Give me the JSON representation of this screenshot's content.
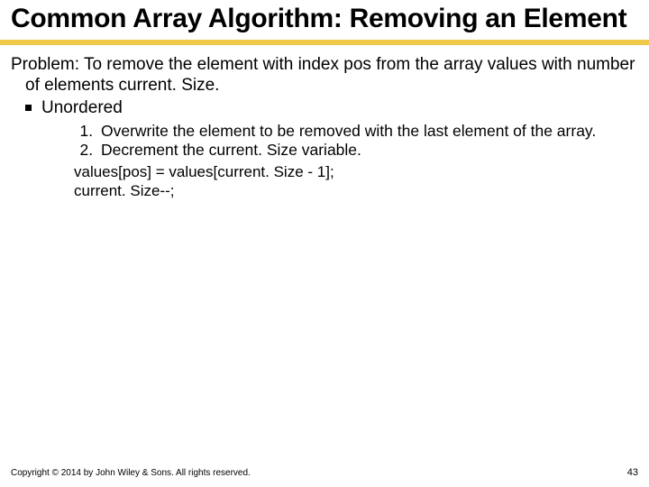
{
  "title": "Common Array Algorithm: Removing an Element",
  "problem": {
    "p1": "Problem: To remove the element with index ",
    "pos": "pos",
    "p2": " from the array ",
    "values": "values",
    "p3": " with number of elements ",
    "current": "current. Size",
    "p4": "."
  },
  "bullets": [
    {
      "label": "Unordered",
      "steps": [
        "Overwrite the element to be removed with the last element of the array."
      ],
      "step2a": "Decrement the ",
      "step2var": "current. Size",
      "step2b": " variable."
    }
  ],
  "code": [
    "values[pos] = values[current. Size - 1];",
    "current. Size--;"
  ],
  "footer": {
    "copyright": "Copyright © 2014 by John Wiley & Sons. All rights reserved.",
    "page": "43"
  }
}
